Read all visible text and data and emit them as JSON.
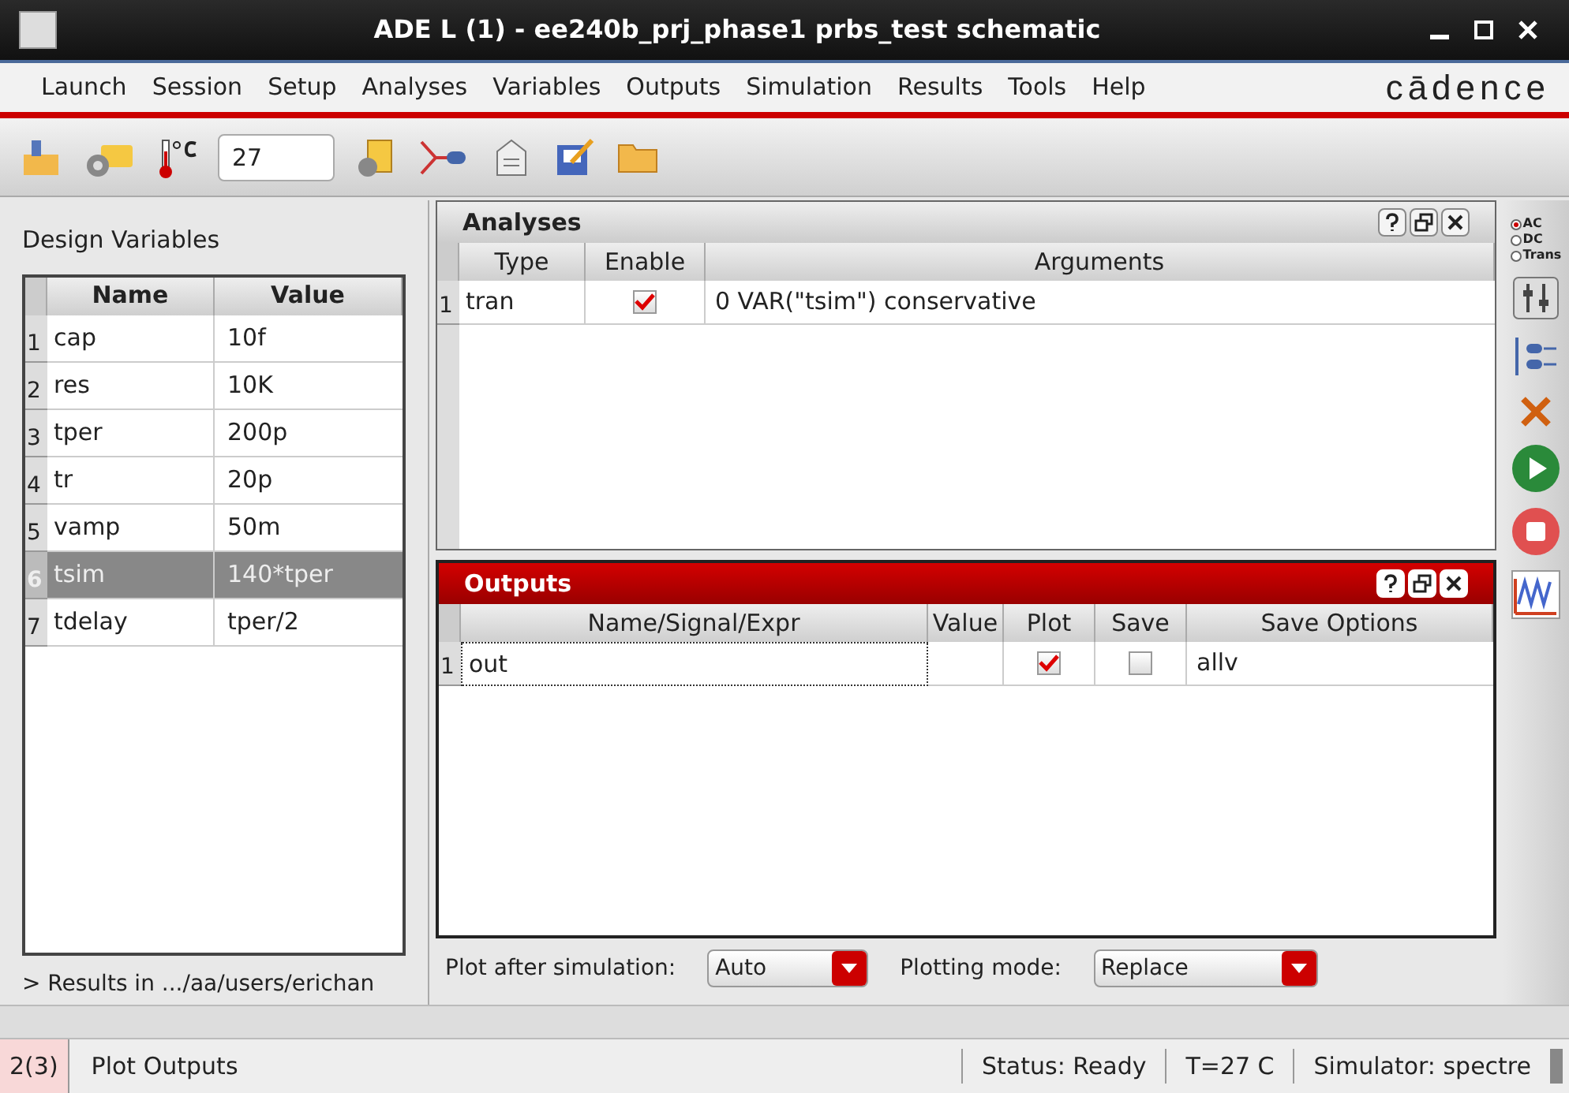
{
  "window": {
    "title": "ADE L (1) - ee240b_prj_phase1 prbs_test schematic",
    "logo": "cādence"
  },
  "menu": [
    "Launch",
    "Session",
    "Setup",
    "Analyses",
    "Variables",
    "Outputs",
    "Simulation",
    "Results",
    "Tools",
    "Help"
  ],
  "toolbar": {
    "temperature": "27"
  },
  "design_variables": {
    "title": "Design Variables",
    "columns": [
      "Name",
      "Value"
    ],
    "rows": [
      {
        "index": "1",
        "name": "cap",
        "value": "10f",
        "selected": false
      },
      {
        "index": "2",
        "name": "res",
        "value": "10K",
        "selected": false
      },
      {
        "index": "3",
        "name": "tper",
        "value": "200p",
        "selected": false
      },
      {
        "index": "4",
        "name": "tr",
        "value": "20p",
        "selected": false
      },
      {
        "index": "5",
        "name": "vamp",
        "value": "50m",
        "selected": false
      },
      {
        "index": "6",
        "name": "tsim",
        "value": "140*tper",
        "selected": true
      },
      {
        "index": "7",
        "name": "tdelay",
        "value": "tper/2",
        "selected": false
      }
    ],
    "results": "> Results in .../aa/users/erichan"
  },
  "analyses": {
    "title": "Analyses",
    "active": false,
    "columns": [
      "Type",
      "Enable",
      "Arguments"
    ],
    "rows": [
      {
        "index": "1",
        "type": "tran",
        "enabled": true,
        "arguments": "0 VAR(\"tsim\") conservative"
      }
    ]
  },
  "outputs": {
    "title": "Outputs",
    "active": true,
    "columns": [
      "Name/Signal/Expr",
      "Value",
      "Plot",
      "Save",
      "Save Options"
    ],
    "rows": [
      {
        "index": "1",
        "name": "out",
        "plot": true,
        "save": false,
        "save_options": "allv"
      }
    ]
  },
  "plot_options": [
    {
      "label": "Plot after simulation:",
      "value": "Auto"
    },
    {
      "label": "Plotting mode:",
      "value": "Replace"
    }
  ],
  "analysis_types": [
    {
      "label": "AC",
      "selected": true
    },
    {
      "label": "DC",
      "selected": false
    },
    {
      "label": "Trans",
      "selected": false
    }
  ],
  "status_bar": {
    "count": "2(3)",
    "message": "Plot Outputs",
    "status": "Status: Ready",
    "temperature": "T=27 C",
    "simulator": "Simulator: spectre"
  }
}
